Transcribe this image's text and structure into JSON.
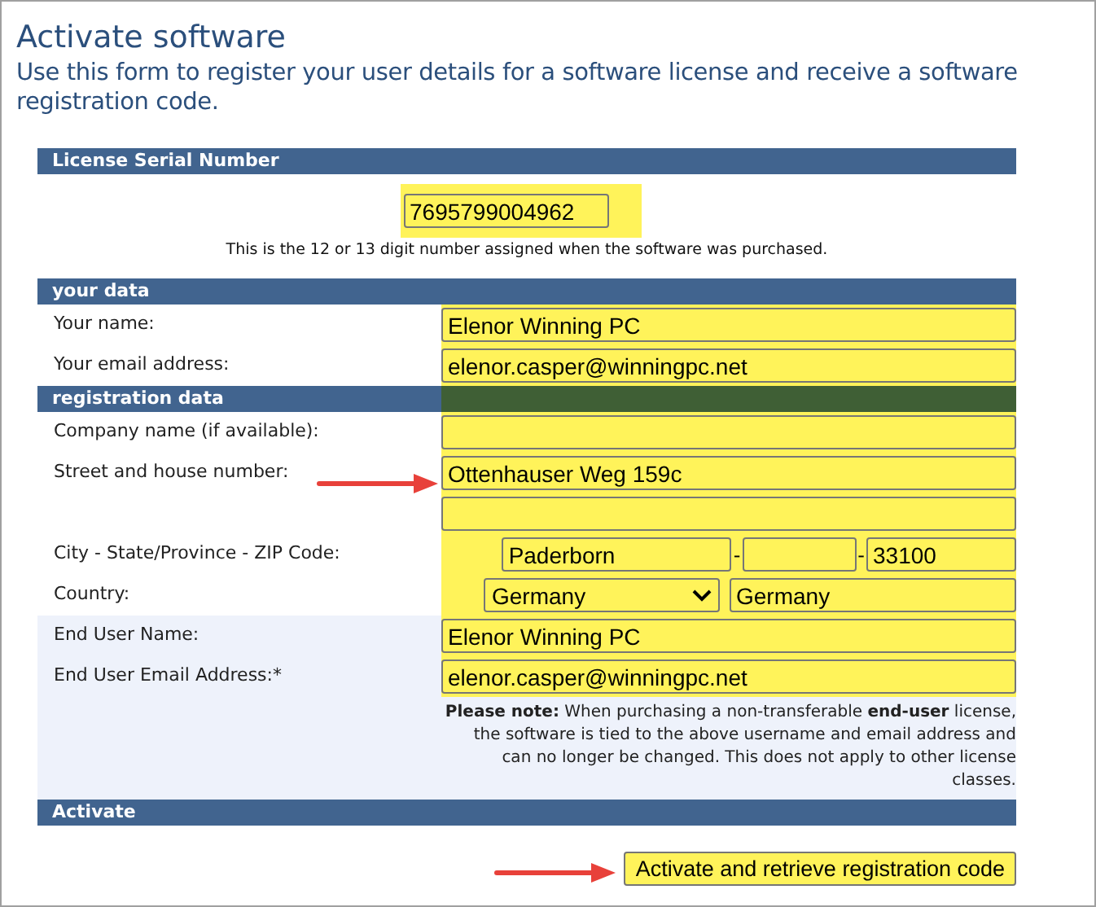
{
  "title": "Activate software",
  "intro": "Use this form to register your user details for a software license and receive a software registration code.",
  "serial": {
    "header": "License Serial Number",
    "value": "7695799004962",
    "hint": "This is the 12 or 13 digit number assigned when the software was purchased."
  },
  "your_data": {
    "header": "your data",
    "fields": [
      {
        "label": "Your name:",
        "value": "Elenor Winning PC"
      },
      {
        "label": "Your email address:",
        "value": "elenor.casper@winningpc.net"
      }
    ]
  },
  "registration": {
    "header": "registration data",
    "rows": [
      {
        "kind": "text",
        "label": "Company name (if available):",
        "value": "",
        "shaded": false
      },
      {
        "kind": "text",
        "label": "Street and house number:",
        "value": "Ottenhauser Weg 159c",
        "shaded": false
      },
      {
        "kind": "text",
        "label": "",
        "value": "",
        "shaded": false
      },
      {
        "kind": "city",
        "label": "City - State/Province - ZIP Code:",
        "city": "Paderborn",
        "state": "",
        "zip": "33100",
        "separator": "-",
        "shaded": false
      },
      {
        "kind": "country",
        "label": "Country:",
        "select": "Germany",
        "value": "Germany",
        "shaded": false
      },
      {
        "kind": "text",
        "label": "End User Name:",
        "value": "Elenor Winning PC",
        "shaded": true
      },
      {
        "kind": "text",
        "label": "End User Email Address:*",
        "value": "elenor.casper@winningpc.net",
        "shaded": true
      }
    ],
    "note": "**Please note:** When purchasing a non-transferable **end-user** license, the software is tied to the above username and email address and can no longer be changed. This does not apply to other license classes."
  },
  "activate": {
    "header": "Activate",
    "button": "Activate and retrieve registration code"
  }
}
